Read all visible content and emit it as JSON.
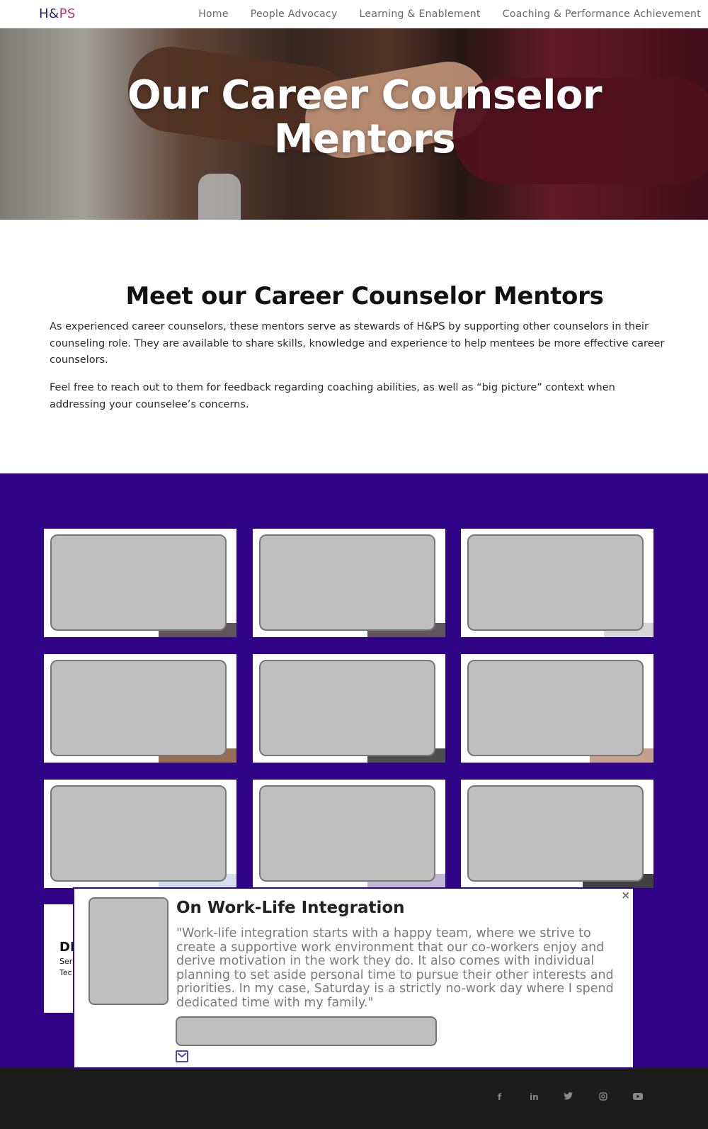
{
  "nav": {
    "logo_part1": "H&",
    "logo_part2": "PS",
    "links": [
      "Home",
      "People Advocacy",
      "Learning & Enablement",
      "Coaching & Performance Achievement"
    ]
  },
  "hero": {
    "title_line1": "Our Career Counselor",
    "title_line2": "Mentors"
  },
  "intro": {
    "heading": "Meet our Career Counselor Mentors",
    "paragraph1": "As experienced career counselors, these mentors serve as stewards of H&PS by supporting other counselors in their counseling role. They are available to share skills, knowledge and experience to help mentees be more effective career counselors.",
    "paragraph2": "Feel free to reach out to them for feedback regarding coaching abilities, as well as “big picture” context when addressing your counselee’s concerns."
  },
  "partial_card": {
    "line1": "DE",
    "line2": "Ser",
    "line3": "Tec"
  },
  "modal": {
    "close": "×",
    "title": "On Work-Life Integration",
    "quote": "\"Work-life integration starts with a happy team, where we strive to create a supportive work environment that our co-workers enjoy and derive motivation in the work they do. It also comes with individual planning to set aside personal time to pursue their other interests and priorities. In my case, Saturday is a strictly no-work day where I spend dedicated time with my family.\""
  },
  "footer": {
    "social": [
      "f",
      "in",
      "t",
      "ig",
      "yt"
    ]
  },
  "colors": {
    "brand_purple": "#2f0487",
    "logo_dark": "#2a1a7a",
    "logo_accent": "#c0307a",
    "footer_bg": "#1c1c1c",
    "placeholder_gray": "#bfbfbf"
  },
  "icons": [
    "close-icon",
    "mail-icon",
    "facebook-icon",
    "linkedin-icon",
    "twitter-icon",
    "instagram-icon",
    "youtube-icon"
  ]
}
